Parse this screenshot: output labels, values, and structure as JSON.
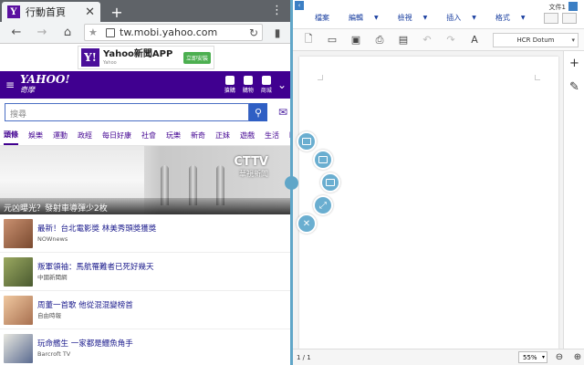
{
  "browser": {
    "tab_title": "行動首頁",
    "tab_favicon": "Y",
    "url": "tw.mobi.yahoo.com",
    "ad": {
      "title": "Yahoo新聞APP",
      "subtitle": "Yahoo",
      "button": "立即安裝"
    },
    "yahoo": {
      "logo": "YAHOO!",
      "logo_sub": "奇摩",
      "header_icons": [
        {
          "icon": "megaphone-icon",
          "label": "搶購"
        },
        {
          "icon": "cart-icon",
          "label": "購物"
        },
        {
          "icon": "store-icon",
          "label": "商城"
        }
      ],
      "search_placeholder": "搜尋",
      "nav": [
        "頭條",
        "娛樂",
        "運動",
        "政經",
        "每日好康",
        "社會",
        "玩樂",
        "新奇",
        "正妹",
        "遊戲",
        "生活",
        "時尚"
      ],
      "hero": {
        "caption": "元凶曝光？發射車導彈少2枚",
        "watermark": "CTTV",
        "watermark_sub": "華視新聞"
      },
      "news": [
        {
          "title": "最新！台北電影獎 林美秀頭獎獲獎",
          "source": "NOWnews",
          "color": "#b07050"
        },
        {
          "title": "叛軍領袖：馬航罹難者已死好幾天",
          "source": "中國新聞網",
          "color": "#6a7a40"
        },
        {
          "title": "周董一首歌 他從混混變榜首",
          "source": "自由時報",
          "color": "#d8a880"
        },
        {
          "title": "玩命艦生 一家都是鱷魚角手",
          "source": "Barcroft TV",
          "color": "#4a5a80"
        }
      ]
    }
  },
  "editor": {
    "filename": "文件1",
    "menus": [
      "檔案",
      "編輯",
      "檢視",
      "插入",
      "格式"
    ],
    "font": "HCR Dotum",
    "page_indicator": "1 / 1",
    "zoom": "55%"
  },
  "colors": {
    "yahoo_purple": "#400090",
    "divider": "#60a6c8",
    "editor_blue": "#1a3fa0"
  }
}
